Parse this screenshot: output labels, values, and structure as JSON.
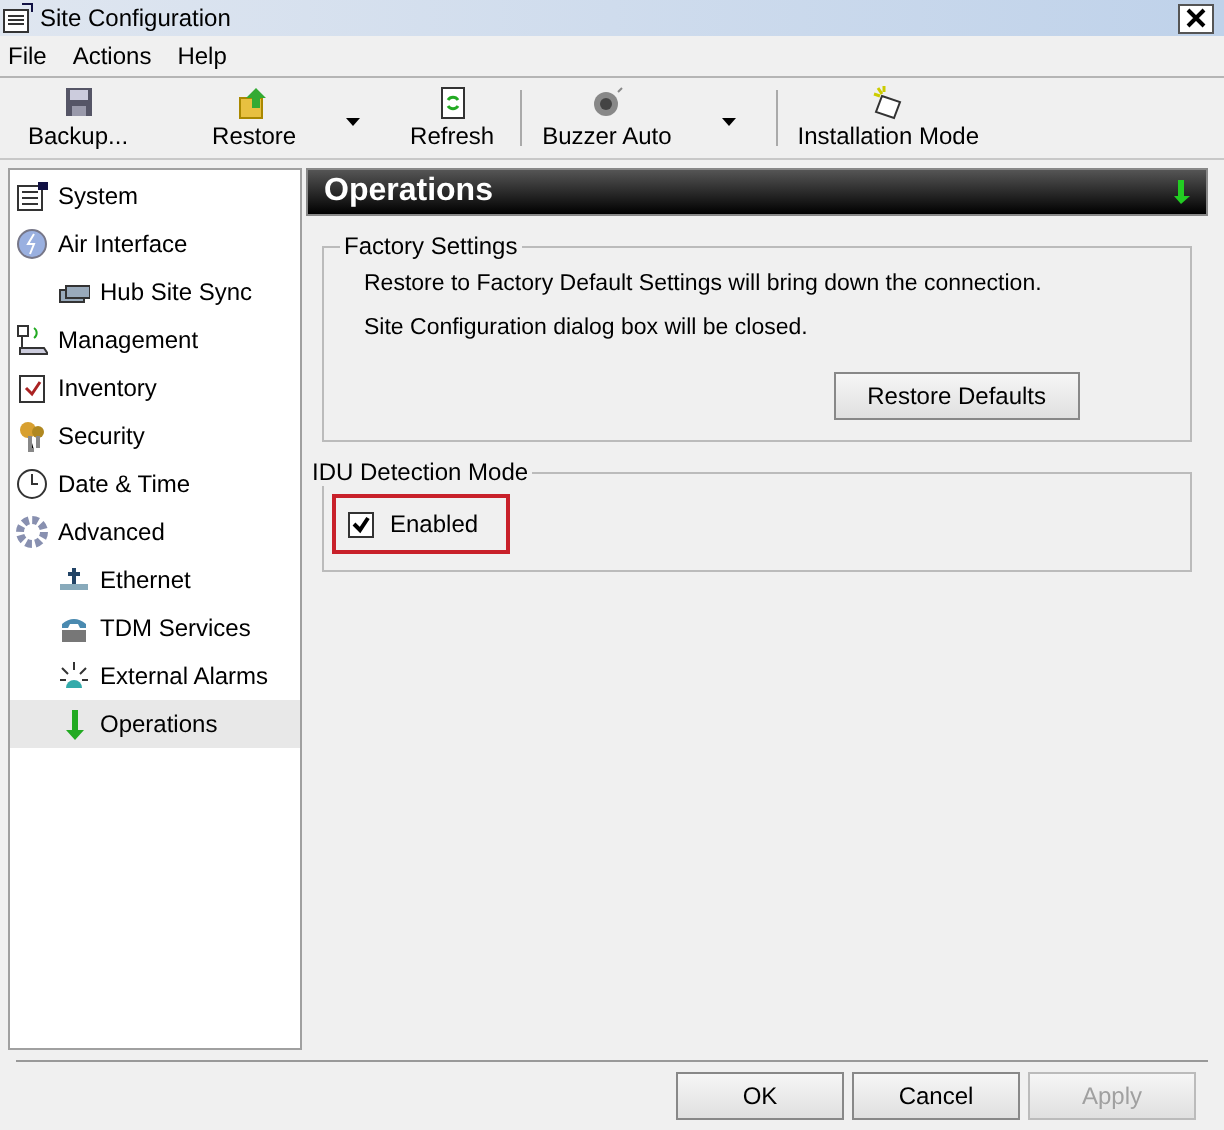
{
  "window": {
    "title": "Site Configuration"
  },
  "menu": [
    "File",
    "Actions",
    "Help"
  ],
  "toolbar": [
    [
      {
        "label": "Backup...",
        "has_menu": false
      },
      {
        "label": "Restore",
        "has_menu": true
      },
      {
        "label": "Refresh",
        "has_menu": false
      }
    ],
    [
      {
        "label": "Buzzer Auto",
        "has_menu": true
      }
    ],
    [
      {
        "label": "Installation Mode",
        "has_menu": false
      }
    ]
  ],
  "sidebar": {
    "items": [
      {
        "label": "System",
        "selected": false
      },
      {
        "label": "Air Interface",
        "selected": false,
        "children": [
          {
            "label": "Hub Site Sync",
            "selected": false
          }
        ]
      },
      {
        "label": "Management",
        "selected": false
      },
      {
        "label": "Inventory",
        "selected": false
      },
      {
        "label": "Security",
        "selected": false
      },
      {
        "label": "Date & Time",
        "selected": false
      },
      {
        "label": "Advanced",
        "selected": false,
        "children": [
          {
            "label": "Ethernet",
            "selected": false
          },
          {
            "label": "TDM Services",
            "selected": false
          },
          {
            "label": "External Alarms",
            "selected": false
          },
          {
            "label": "Operations",
            "selected": true
          }
        ]
      }
    ]
  },
  "panel": {
    "title": "Operations",
    "factory_settings": {
      "legend": "Factory Settings",
      "lines": [
        "Restore to Factory Default Settings will bring down the connection.",
        "Site Configuration dialog box will be closed."
      ],
      "button": "Restore Defaults"
    },
    "idu_detection": {
      "legend": "IDU Detection Mode",
      "checkbox": {
        "label": "Enabled",
        "checked": true,
        "highlighted": true
      }
    }
  },
  "buttons": [
    {
      "label": "OK",
      "disabled": false
    },
    {
      "label": "Cancel",
      "disabled": false
    },
    {
      "label": "Apply",
      "disabled": true
    }
  ]
}
